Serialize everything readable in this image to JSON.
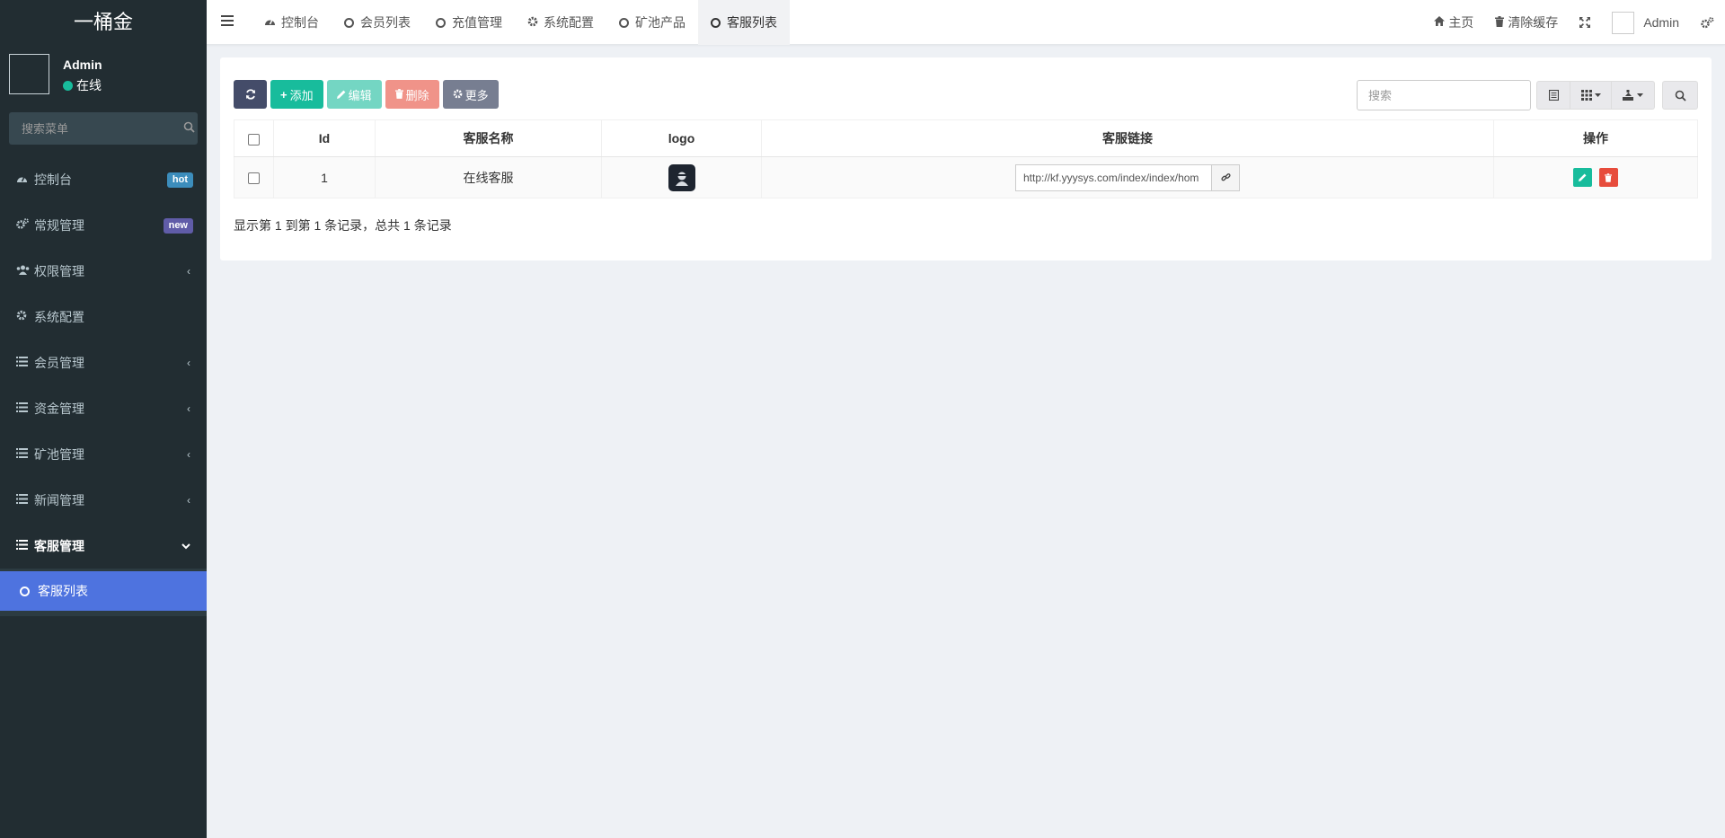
{
  "brand": "一桶金",
  "user": {
    "name": "Admin",
    "status": "在线"
  },
  "sidebar": {
    "search_placeholder": "搜索菜单",
    "items": [
      {
        "label": "控制台",
        "icon": "dashboard-icon",
        "badge": "hot",
        "badge_color": "#3c8dbc"
      },
      {
        "label": "常规管理",
        "icon": "cogs-icon",
        "badge": "new",
        "badge_color": "#605ca8"
      },
      {
        "label": "权限管理",
        "icon": "group-icon"
      },
      {
        "label": "系统配置",
        "icon": "gear-icon"
      },
      {
        "label": "会员管理",
        "icon": "list-icon"
      },
      {
        "label": "资金管理",
        "icon": "list-icon"
      },
      {
        "label": "矿池管理",
        "icon": "list-icon"
      },
      {
        "label": "新闻管理",
        "icon": "list-icon"
      },
      {
        "label": "客服管理",
        "icon": "list-icon"
      }
    ],
    "sub_items": [
      {
        "label": "客服列表",
        "icon": "circle-icon"
      }
    ]
  },
  "topnav": {
    "tabs": [
      {
        "label": "控制台",
        "icon": "dashboard-icon"
      },
      {
        "label": "会员列表",
        "icon": "circle-icon"
      },
      {
        "label": "充值管理",
        "icon": "circle-icon"
      },
      {
        "label": "系统配置",
        "icon": "gear-icon"
      },
      {
        "label": "矿池产品",
        "icon": "circle-icon"
      },
      {
        "label": "客服列表",
        "icon": "circle-icon"
      }
    ],
    "home": "主页",
    "clear_cache": "清除缓存",
    "admin": "Admin"
  },
  "toolbar": {
    "add": "添加",
    "edit": "编辑",
    "delete": "删除",
    "more": "更多",
    "search_placeholder": "搜索"
  },
  "table": {
    "headers": [
      "Id",
      "客服名称",
      "logo",
      "客服链接",
      "操作"
    ],
    "rows": [
      {
        "id": "1",
        "name": "在线客服",
        "link": "http://kf.yyysys.com/index/index/hom"
      }
    ]
  },
  "pagination_info": "显示第 1 到第 1 条记录，总共 1 条记录",
  "colors": {
    "accent": "#18bc9c",
    "sidebar_bg": "#222d32",
    "active_menu": "#4e73df",
    "danger": "#e74c3c"
  }
}
